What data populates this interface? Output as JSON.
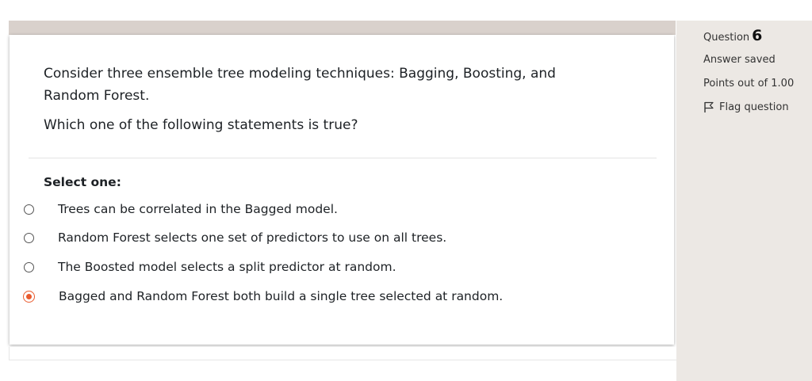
{
  "question": {
    "text_line1": "Consider three ensemble tree modeling techniques: Bagging, Boosting, and Random Forest.",
    "text_line2": "Which one of the following statements is true?",
    "prompt": "Select one:",
    "options": [
      {
        "label": "Trees can be correlated in the Bagged model.",
        "selected": false
      },
      {
        "label": "Random Forest selects one set of predictors to use on all trees.",
        "selected": false
      },
      {
        "label": "The Boosted model selects a split predictor at random.",
        "selected": false
      },
      {
        "label": "Bagged and Random Forest both build a single tree selected at random.",
        "selected": true
      }
    ]
  },
  "info": {
    "question_label": "Question",
    "question_number": "6",
    "status": "Answer saved",
    "points": "Points out of 1.00",
    "flag_label": "Flag question",
    "flag_icon": "flag-icon"
  },
  "colors": {
    "accent": "#e95b2e",
    "sidebar_bg": "#ece8e4",
    "topbar_bg": "#d9d1cc"
  }
}
